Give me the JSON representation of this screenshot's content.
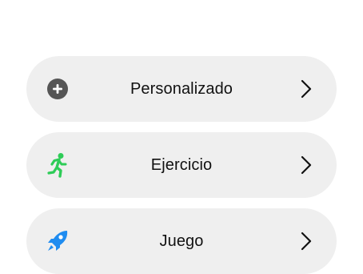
{
  "menu": {
    "items": [
      {
        "label": "Personalizado",
        "icon": "plus-circle-icon",
        "icon_color": "#555555"
      },
      {
        "label": "Ejercicio",
        "icon": "running-figure-icon",
        "icon_color": "#2ecc57"
      },
      {
        "label": "Juego",
        "icon": "rocket-icon",
        "icon_color": "#1f8cf0"
      }
    ]
  },
  "colors": {
    "row_background": "#efefef",
    "text": "#111111",
    "chevron": "#111111"
  }
}
